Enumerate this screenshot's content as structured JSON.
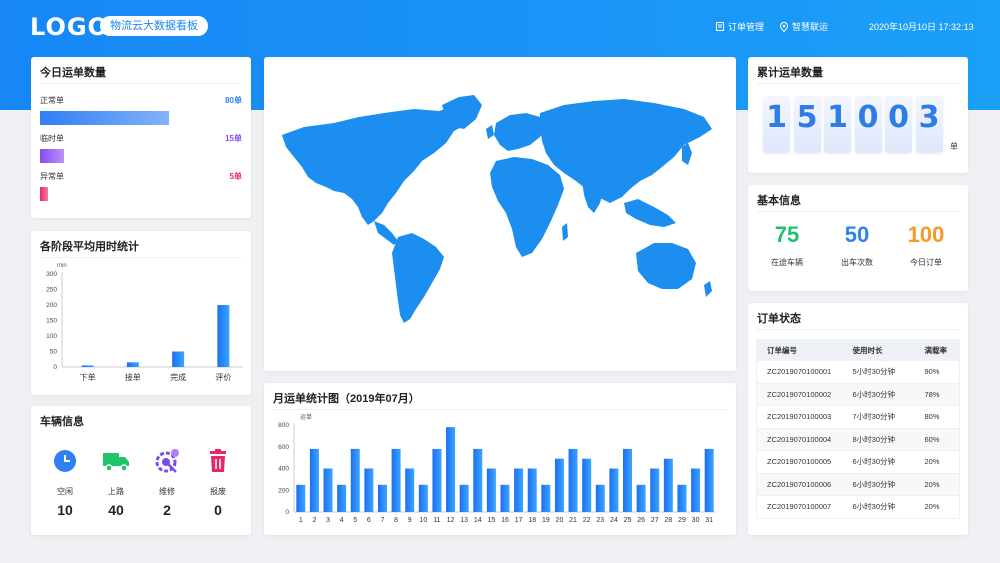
{
  "header": {
    "logo": "LOGO",
    "subtitle": "物流云大数据看板",
    "nav_orders": "订单管理",
    "nav_transport": "智慧联运",
    "datetime": "2020年10月10日  17:32:13"
  },
  "today_orders": {
    "title": "今日运单数量",
    "items": [
      {
        "label": "正常单",
        "value_text": "80单",
        "value": 80,
        "color": "#2f7ff5"
      },
      {
        "label": "临时单",
        "value_text": "15单",
        "value": 15,
        "color": "#8a4af2"
      },
      {
        "label": "异常单",
        "value_text": "5单",
        "value": 5,
        "color": "#e8266a"
      }
    ]
  },
  "stage_time": {
    "title": "各阶段平均用时统计",
    "unit": "min",
    "chart_data": {
      "type": "bar",
      "categories": [
        "下单",
        "接单",
        "完成",
        "评价"
      ],
      "values": [
        5,
        15,
        50,
        200
      ],
      "ylabel": "min",
      "ylim": [
        0,
        300
      ],
      "yticks": [
        0,
        50,
        100,
        150,
        200,
        250,
        300
      ]
    }
  },
  "vehicles": {
    "title": "车辆信息",
    "items": [
      {
        "label": "空闲",
        "value": "10",
        "icon": "clock-icon",
        "color": "#2f80f5"
      },
      {
        "label": "上路",
        "value": "40",
        "icon": "truck-icon",
        "color": "#1fc56b"
      },
      {
        "label": "维修",
        "value": "2",
        "icon": "wrench-gear-icon",
        "color": "#7a4cf0"
      },
      {
        "label": "报废",
        "value": "0",
        "icon": "trash-icon",
        "color": "#e8266a"
      }
    ]
  },
  "monthly": {
    "title": "月运单统计图（2019年07月）",
    "unit": "运单",
    "chart_data": {
      "type": "bar",
      "categories": [
        "1",
        "2",
        "3",
        "4",
        "5",
        "6",
        "7",
        "8",
        "9",
        "10",
        "11",
        "12",
        "13",
        "14",
        "15",
        "16",
        "17",
        "18",
        "19",
        "20",
        "21",
        "22",
        "23",
        "24",
        "25",
        "26",
        "27",
        "28",
        "29",
        "30",
        "31"
      ],
      "values": [
        250,
        580,
        400,
        250,
        580,
        400,
        250,
        580,
        400,
        250,
        580,
        780,
        250,
        580,
        400,
        250,
        400,
        400,
        250,
        490,
        580,
        490,
        250,
        400,
        580,
        250,
        400,
        490,
        250,
        400,
        580
      ],
      "ylabel": "运单",
      "ylim": [
        0,
        800
      ],
      "yticks": [
        0,
        200,
        400,
        600,
        800
      ]
    }
  },
  "cumulative": {
    "title": "累计运单数量",
    "digits": [
      "1",
      "5",
      "1",
      "0",
      "0",
      "3"
    ],
    "unit": "单"
  },
  "basic_info": {
    "title": "基本信息",
    "stats": [
      {
        "value": "75",
        "label": "在途车辆",
        "color": "#21c06a"
      },
      {
        "value": "50",
        "label": "出车次数",
        "color": "#2f7ff5"
      },
      {
        "value": "100",
        "label": "今日订单",
        "color": "#f59a23"
      }
    ]
  },
  "order_status": {
    "title": "订单状态",
    "columns": [
      "订单编号",
      "使用时长",
      "满载率"
    ],
    "rows": [
      [
        "ZC2019070100001",
        "5小时30分钟",
        "90%"
      ],
      [
        "ZC2019070100002",
        "6小时30分钟",
        "78%"
      ],
      [
        "ZC2019070100003",
        "7小时30分钟",
        "80%"
      ],
      [
        "ZC2019070100004",
        "8小时30分钟",
        "60%"
      ],
      [
        "ZC2019070100005",
        "6小时30分钟",
        "20%"
      ],
      [
        "ZC2019070100006",
        "6小时30分钟",
        "20%"
      ],
      [
        "ZC2019070100007",
        "6小时30分钟",
        "20%"
      ]
    ]
  },
  "colors": {
    "primary": "#1687f5",
    "map_fill": "#1b8ef0"
  }
}
